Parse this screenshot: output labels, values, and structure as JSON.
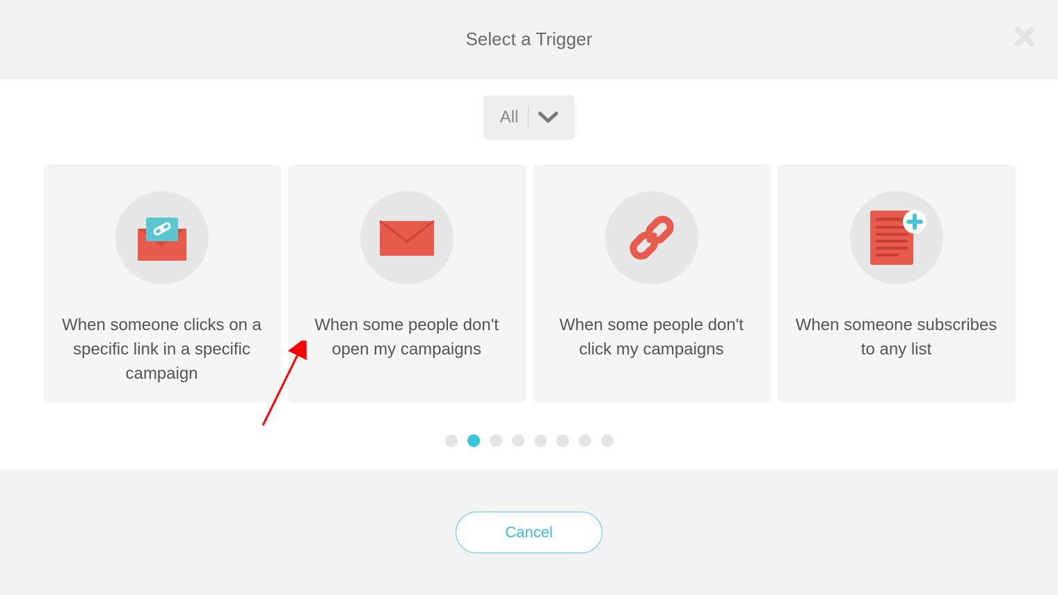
{
  "header": {
    "title": "Select a Trigger"
  },
  "filter": {
    "label": "All"
  },
  "cards": [
    {
      "label": "When someone clicks on a specific link in a specific campaign",
      "icon": "envelope-link"
    },
    {
      "label": "When some people don't open my campaigns",
      "icon": "envelope"
    },
    {
      "label": "When some people don't click my campaigns",
      "icon": "link"
    },
    {
      "label": "When someone subscribes to any list",
      "icon": "list-add"
    }
  ],
  "pagination": {
    "total": 8,
    "active_index": 1
  },
  "footer": {
    "cancel_label": "Cancel"
  }
}
